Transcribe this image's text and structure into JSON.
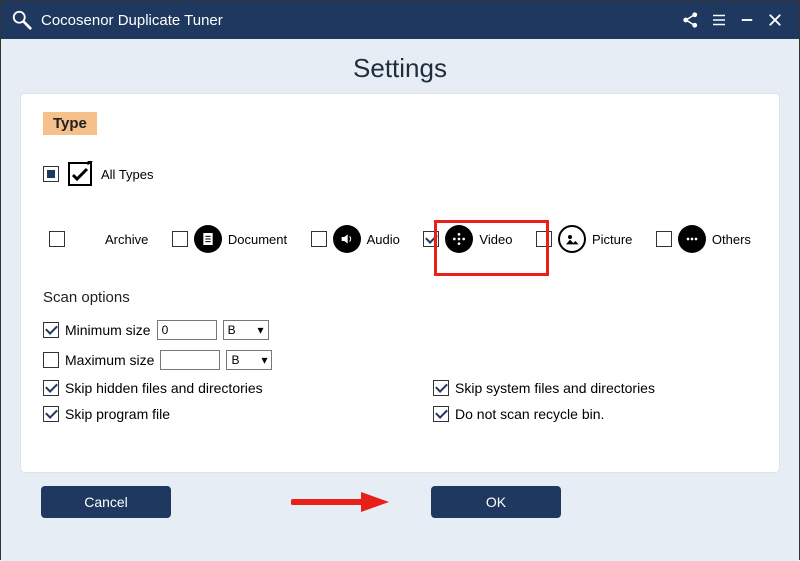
{
  "app": {
    "title": "Cocosenor Duplicate Tuner"
  },
  "page": {
    "title": "Settings"
  },
  "type_section": {
    "header": "Type",
    "all_types_label": "All Types",
    "items": [
      {
        "label": "Archive"
      },
      {
        "label": "Document"
      },
      {
        "label": "Audio"
      },
      {
        "label": "Video"
      },
      {
        "label": "Picture"
      },
      {
        "label": "Others"
      }
    ]
  },
  "scan": {
    "header": "Scan options",
    "min_label": "Minimum size",
    "min_value": "0",
    "min_unit": "B",
    "max_label": "Maximum size",
    "max_value": "",
    "max_unit": "B",
    "skip_hidden": "Skip hidden files and directories",
    "skip_system": "Skip system files and directories",
    "skip_program": "Skip program file",
    "no_recycle": "Do not scan recycle bin."
  },
  "buttons": {
    "cancel": "Cancel",
    "ok": "OK"
  }
}
